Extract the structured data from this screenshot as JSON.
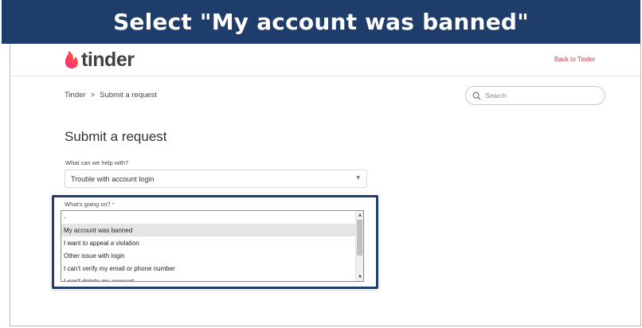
{
  "banner": {
    "text": "Select \"My account was banned\""
  },
  "header": {
    "logo_text": "tinder",
    "back_link": "Back to Tinder"
  },
  "breadcrumb": {
    "items": [
      "Tinder",
      "Submit a request"
    ],
    "separator": ">"
  },
  "search": {
    "placeholder": "Search"
  },
  "page": {
    "title": "Submit a request"
  },
  "form": {
    "q1_label": "What can we help with?",
    "q1_value": "Trouble with account login",
    "q2_label": "What's going on?",
    "q2_required": "*",
    "q2_options": [
      "-",
      "My account was banned",
      "I want to appeal a violation",
      "Other issue with login",
      "I can't verify my email or phone number",
      "I can't delete my account"
    ],
    "q2_selected": "My account was banned"
  },
  "colors": {
    "banner": "#1f3d6b",
    "brand": "#fd5068",
    "link": "#c8384b"
  }
}
